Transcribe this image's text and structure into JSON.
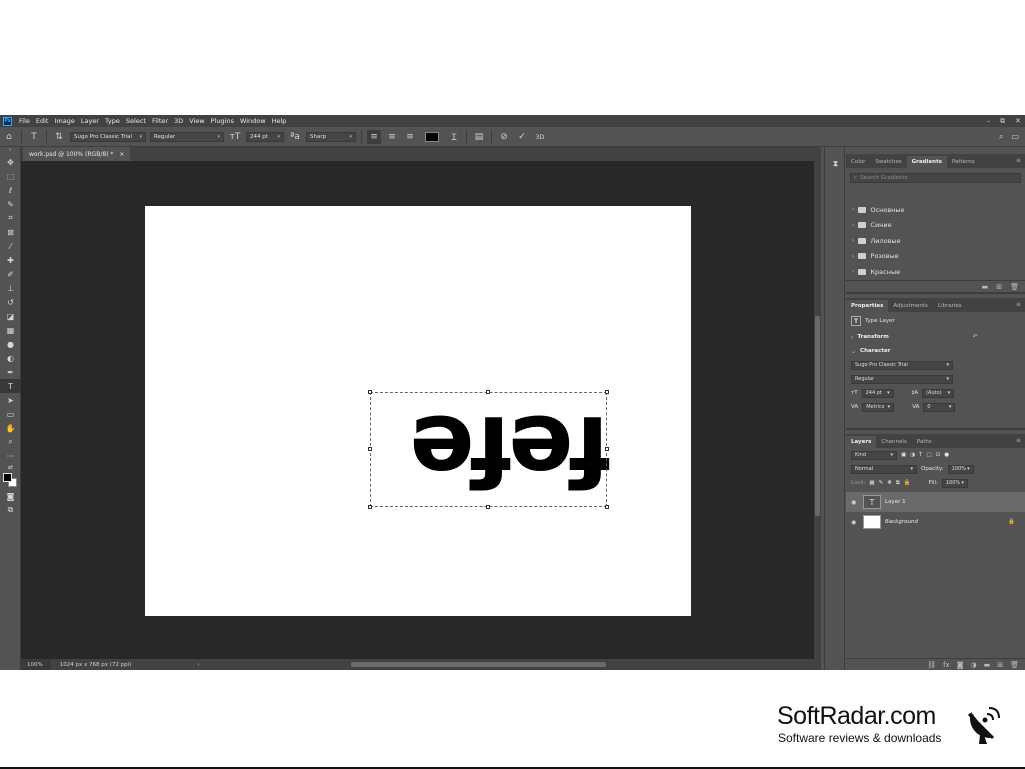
{
  "menubar": {
    "logo": "Ps",
    "items": [
      "File",
      "Edit",
      "Image",
      "Layer",
      "Type",
      "Select",
      "Filter",
      "3D",
      "View",
      "Plugins",
      "Window",
      "Help"
    ],
    "window_controls": [
      "–",
      "⧉",
      "✕"
    ]
  },
  "options": {
    "font_family": "Sugo Pro Classic Trial",
    "font_style": "Regular",
    "font_size": "244 pt",
    "anti_alias_label": "ªa",
    "anti_alias": "Sharp",
    "text_color": "#000000",
    "cancel_icon": "cancel-icon",
    "commit_icon": "check-icon",
    "three_d_label": "3D"
  },
  "document": {
    "tab_title": "work.psd @ 100% (RGB/8) *",
    "tab_close": "×",
    "canvas_text": "fefe",
    "zoom": "100%",
    "info": "1024 px x 768 px (72 ppi)",
    "status_arrow": "›"
  },
  "gradients_panel": {
    "tabs": [
      "Color",
      "Swatches",
      "Gradients",
      "Patterns"
    ],
    "active_tab": "Gradients",
    "search_placeholder": "Search Gradients",
    "folders": [
      "Основные",
      "Синие",
      "Лиловые",
      "Розовые",
      "Красные"
    ]
  },
  "properties_panel": {
    "tabs": [
      "Properties",
      "Adjustments",
      "Libraries"
    ],
    "active_tab": "Properties",
    "layer_type": "Type Layer",
    "transform_label": "Transform",
    "character_label": "Character",
    "font_family": "Sugo Pro Classic Trial",
    "font_style": "Regular",
    "font_size": "244 pt",
    "leading": "(Auto)",
    "kerning": "Metrics",
    "tracking": "0"
  },
  "layers_panel": {
    "tabs": [
      "Layers",
      "Channels",
      "Paths"
    ],
    "active_tab": "Layers",
    "filter_placeholder": "Kind",
    "blend_mode": "Normal",
    "opacity_label": "Opacity:",
    "opacity": "100%",
    "lock_label": "Lock:",
    "fill_label": "Fill:",
    "fill": "100%",
    "layers": [
      {
        "name": "Layer 1",
        "kind": "type",
        "selected": true
      },
      {
        "name": "Background",
        "kind": "pixel",
        "selected": false
      }
    ]
  },
  "brand": {
    "name": "SoftRadar.com",
    "tagline": "Software reviews & downloads"
  },
  "colors": {
    "ui_dark": "#424242",
    "ui_mid": "#535353",
    "workspace": "#282828",
    "accent": "#31a8ff"
  }
}
